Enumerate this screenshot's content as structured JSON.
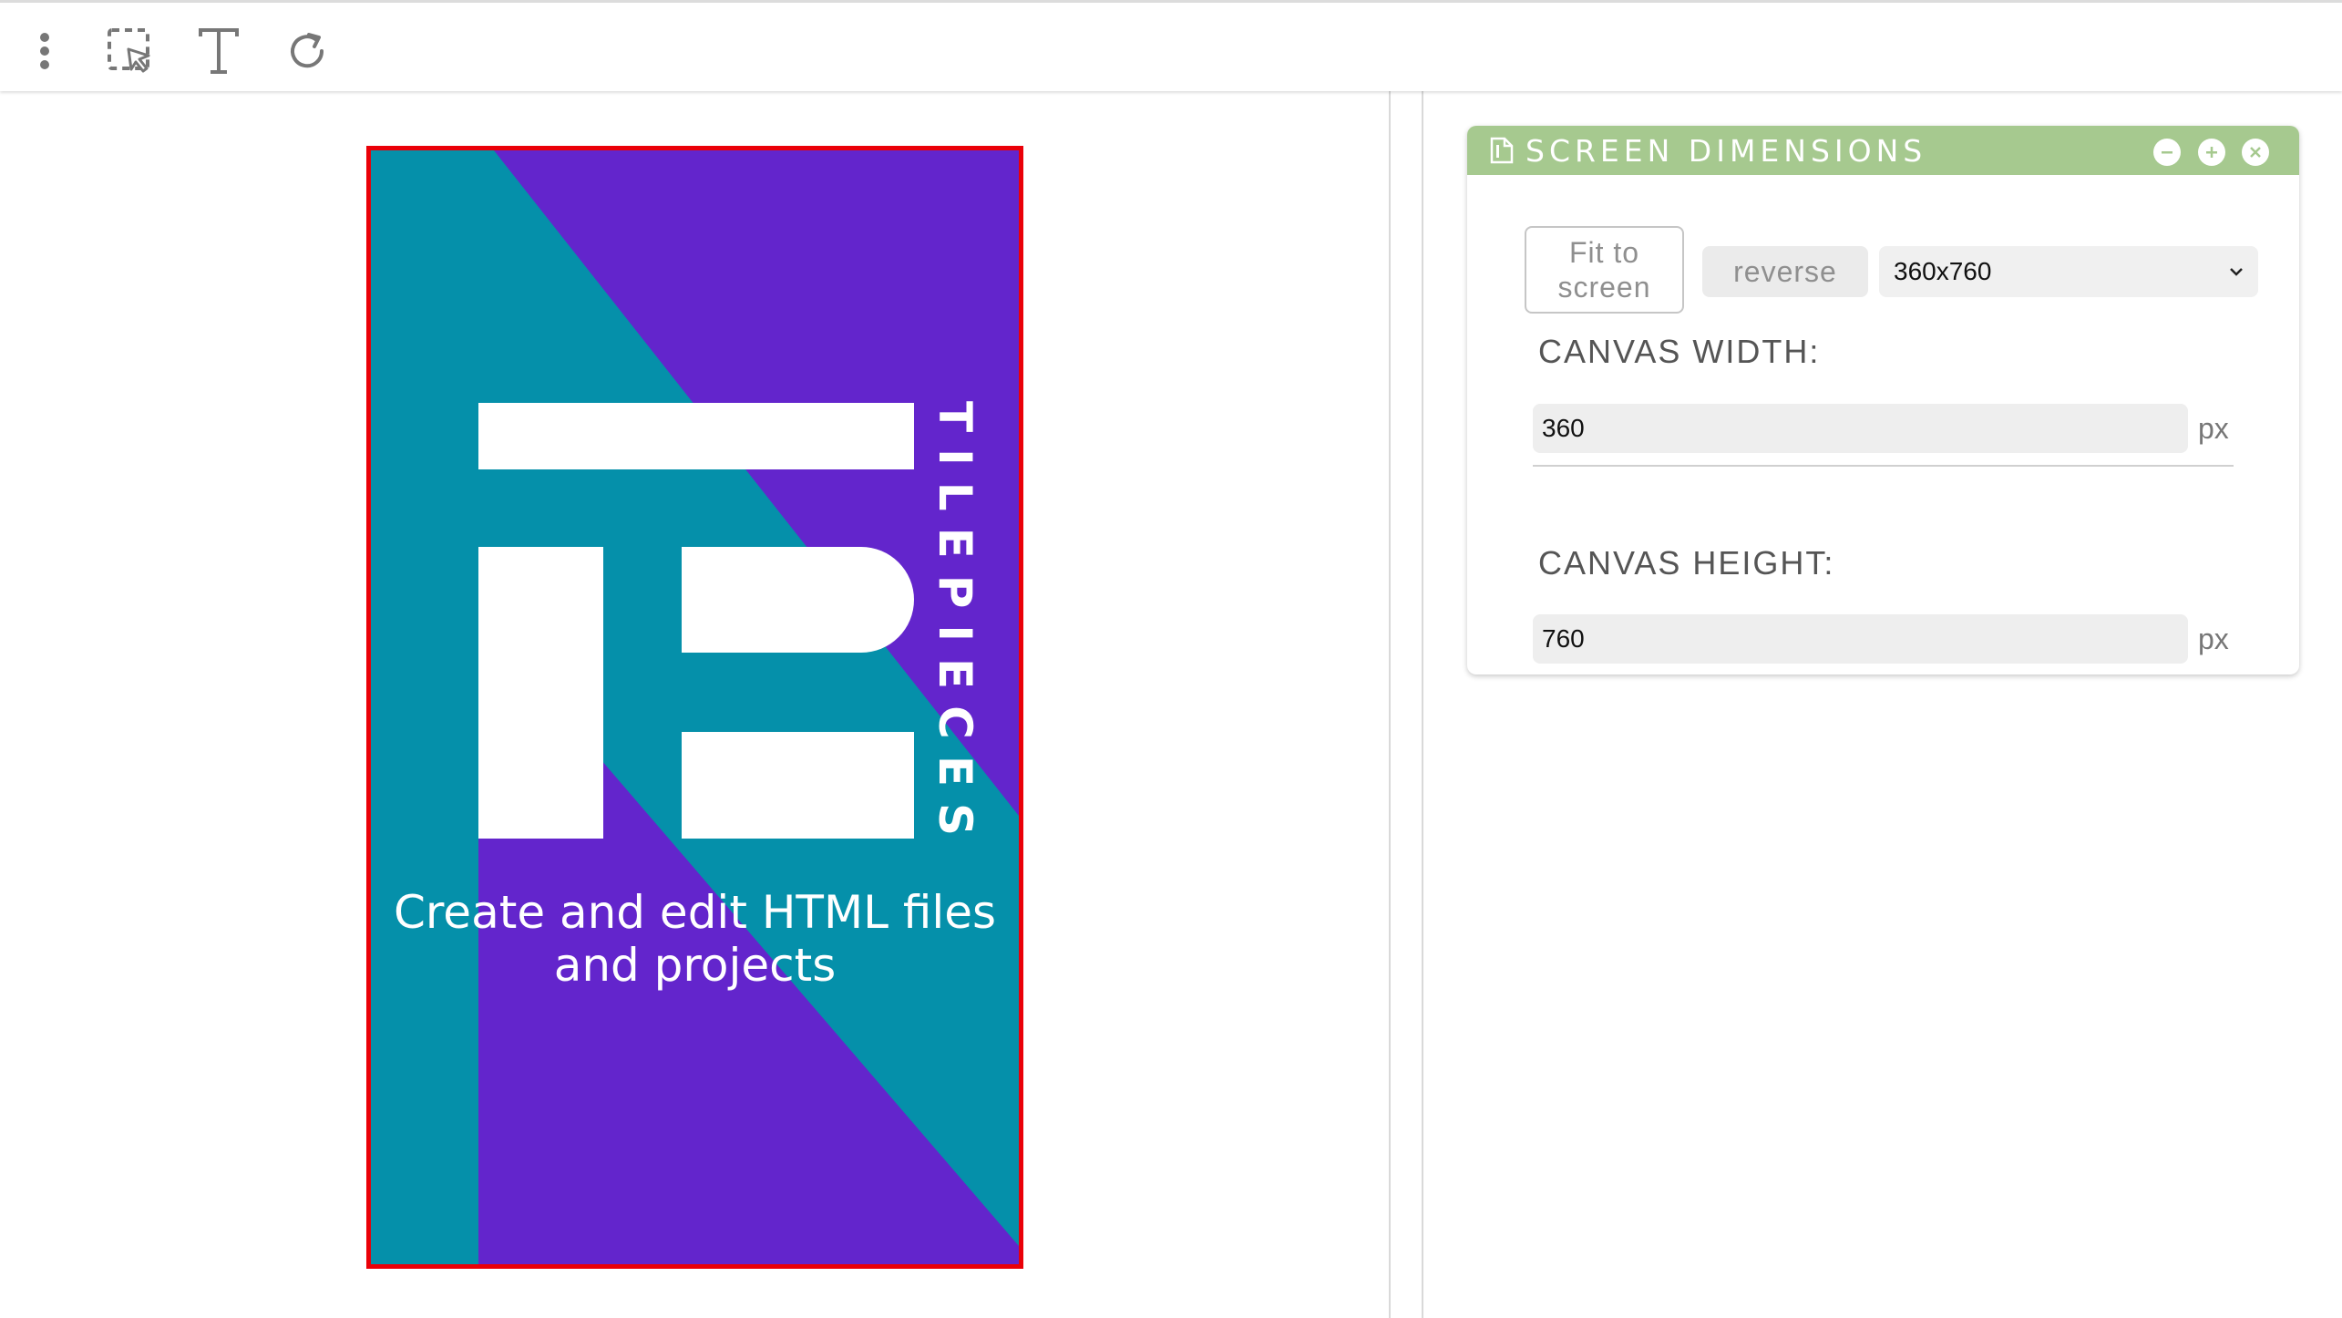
{
  "toolbar": {
    "tools": [
      {
        "icon": "more-vertical-icon"
      },
      {
        "icon": "select-cursor-icon"
      },
      {
        "icon": "text-icon"
      },
      {
        "icon": "refresh-icon"
      }
    ]
  },
  "artboard": {
    "border_color": "#ea0008",
    "colors": {
      "teal": "#0590aa",
      "purple": "#6325cc",
      "white": "#ffffff"
    },
    "brand_name": "TILEPIECES",
    "tagline_line1": "Create and edit HTML files",
    "tagline_line2": "and projects"
  },
  "panel": {
    "title": "SCREEN DIMENSIONS",
    "header_color": "#a6c98f",
    "icons": {
      "title": "document-icon",
      "minimize": "minimize-icon",
      "maximize": "plus-icon",
      "close": "close-icon"
    },
    "fit_line1": "Fit to",
    "fit_line2": "screen",
    "reverse_label": "reverse",
    "selected_size": "360x760",
    "width_label": "CANVAS WIDTH:",
    "width_value": "360",
    "height_label": "CANVAS HEIGHT:",
    "height_value": "760",
    "unit": "px"
  }
}
